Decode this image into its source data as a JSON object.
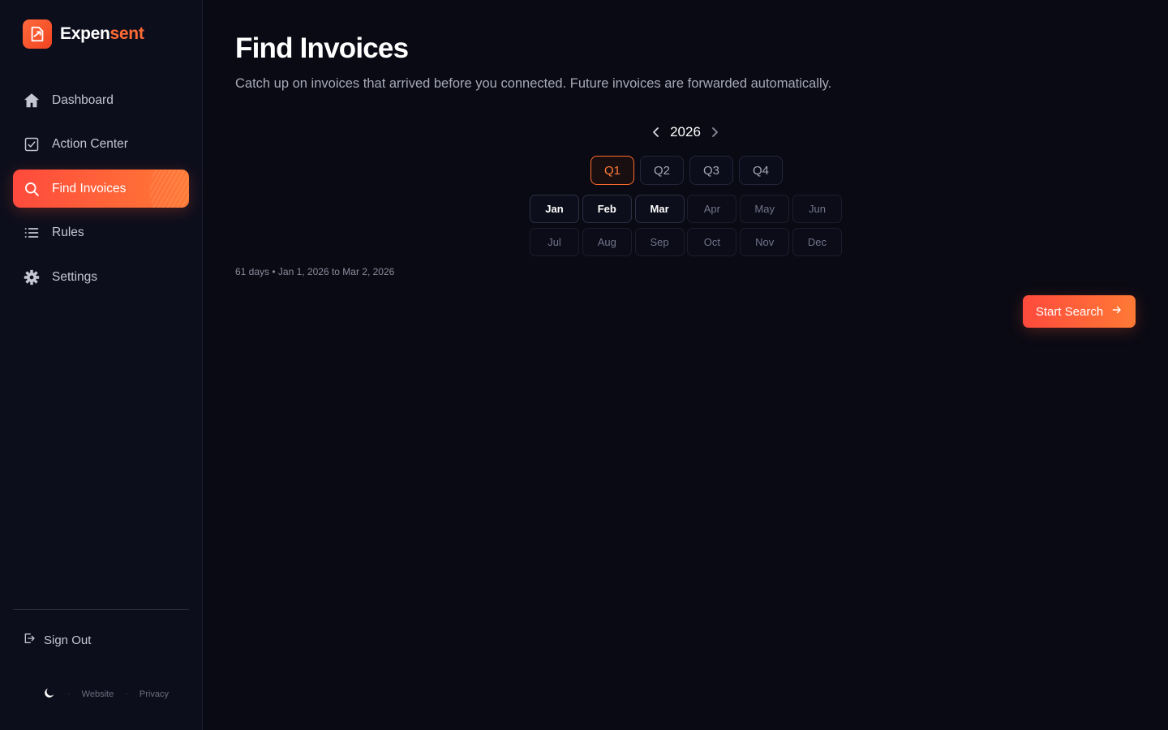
{
  "brand": {
    "name_part1": "Expen",
    "name_part2": "sent",
    "accent": "#ff6b35"
  },
  "sidebar": {
    "items": [
      {
        "label": "Dashboard",
        "icon": "home-icon",
        "active": false
      },
      {
        "label": "Action Center",
        "icon": "checkbox-icon",
        "active": false
      },
      {
        "label": "Find Invoices",
        "icon": "search-icon",
        "active": true
      },
      {
        "label": "Rules",
        "icon": "list-icon",
        "active": false
      },
      {
        "label": "Settings",
        "icon": "gear-icon",
        "active": false
      }
    ],
    "signout_label": "Sign Out",
    "footer": {
      "theme_icon": "moon-icon",
      "website_label": "Website",
      "privacy_label": "Privacy"
    }
  },
  "page": {
    "title": "Find Invoices",
    "subtitle": "Catch up on invoices that arrived before you connected. Future invoices are forwarded automatically."
  },
  "picker": {
    "year": "2026",
    "quarters": [
      {
        "label": "Q1",
        "active": true
      },
      {
        "label": "Q2",
        "active": false
      },
      {
        "label": "Q3",
        "active": false
      },
      {
        "label": "Q4",
        "active": false
      }
    ],
    "months": [
      {
        "label": "Jan",
        "selected": true
      },
      {
        "label": "Feb",
        "selected": true
      },
      {
        "label": "Mar",
        "selected": true
      },
      {
        "label": "Apr",
        "selected": false
      },
      {
        "label": "May",
        "selected": false
      },
      {
        "label": "Jun",
        "selected": false
      },
      {
        "label": "Jul",
        "selected": false
      },
      {
        "label": "Aug",
        "selected": false
      },
      {
        "label": "Sep",
        "selected": false
      },
      {
        "label": "Oct",
        "selected": false
      },
      {
        "label": "Nov",
        "selected": false
      },
      {
        "label": "Dec",
        "selected": false
      }
    ],
    "range_info": "61 days • Jan 1, 2026 to Mar 2, 2026"
  },
  "actions": {
    "start_search_label": "Start Search"
  }
}
